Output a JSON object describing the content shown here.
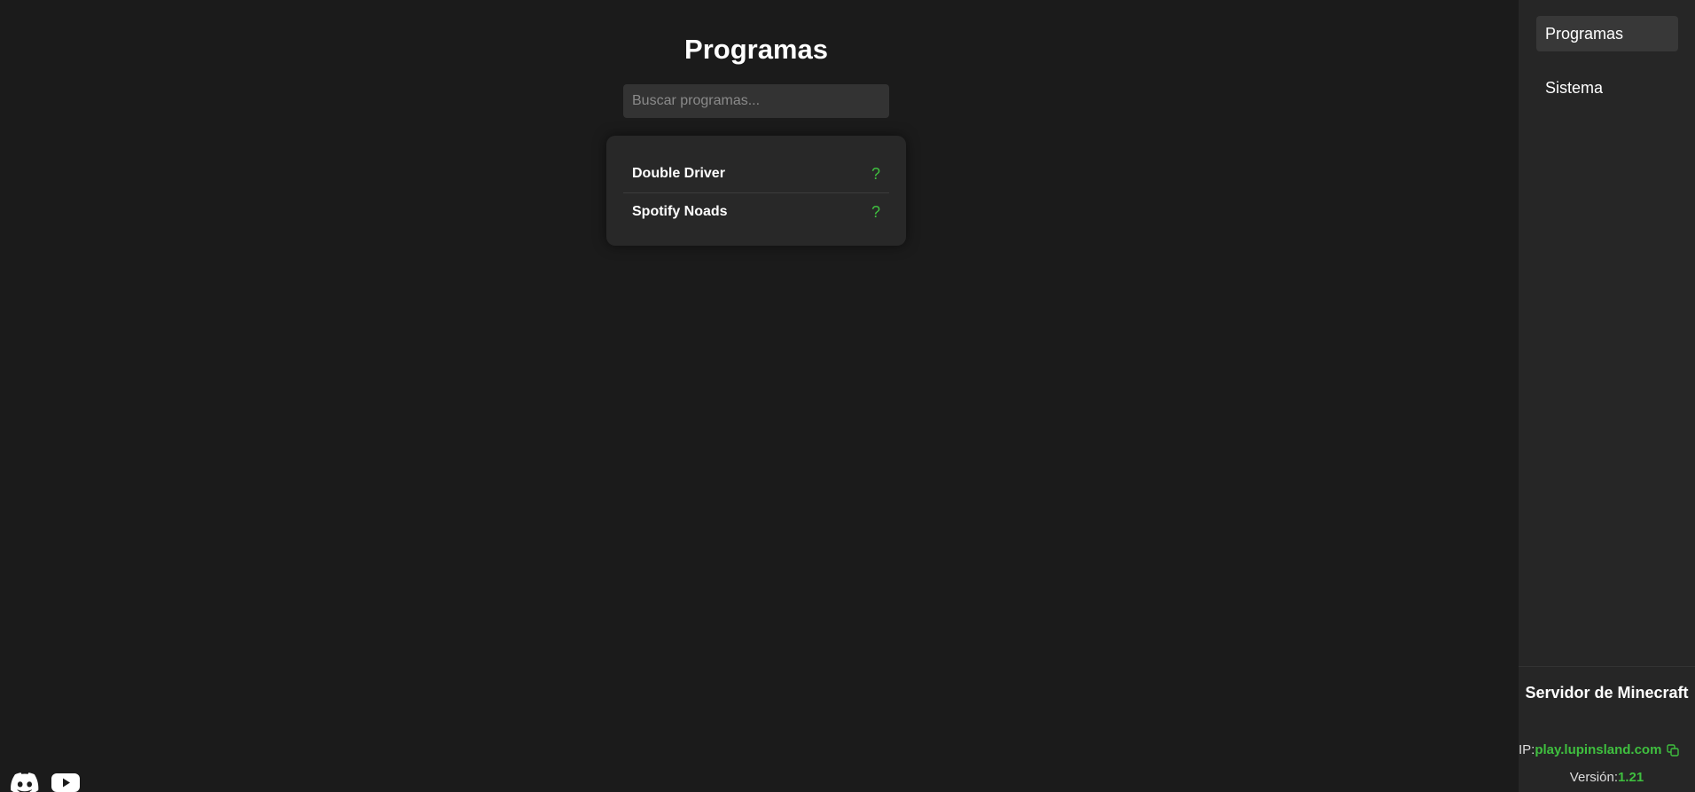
{
  "main": {
    "title": "Programas",
    "search": {
      "placeholder": "Buscar programas...",
      "value": ""
    },
    "programs": [
      {
        "name": "Double Driver",
        "icon": "help-icon",
        "symbol": "?"
      },
      {
        "name": "Spotify Noads",
        "icon": "help-icon",
        "symbol": "?"
      }
    ]
  },
  "social": {
    "icons": [
      "discord-icon",
      "youtube-icon"
    ]
  },
  "sidebar": {
    "items": [
      {
        "label": "Programas",
        "active": true
      },
      {
        "label": "Sistema",
        "active": false
      }
    ],
    "server": {
      "title": "Servidor de Minecraft",
      "ip_label": "IP:",
      "ip_value": "play.lupinsland.com",
      "version_label": "Versión:",
      "version_value": "1.21"
    }
  },
  "colors": {
    "background": "#1b1b1b",
    "sidebar": "#262626",
    "card": "#282828",
    "accent_green": "#3fbf3f"
  }
}
